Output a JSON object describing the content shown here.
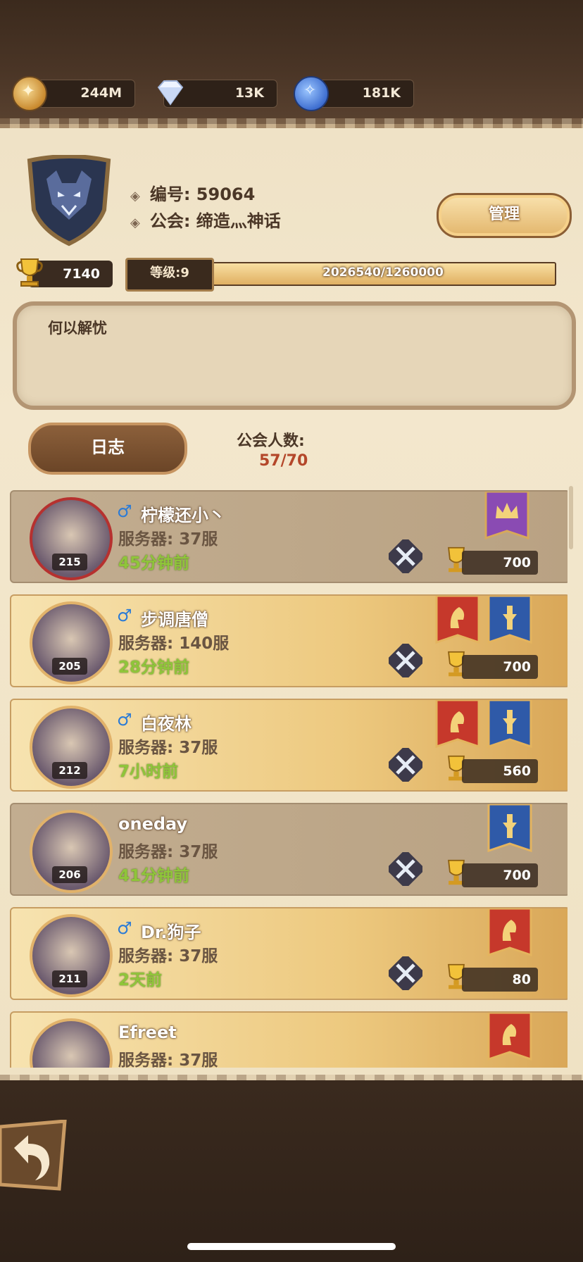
{
  "currencies": [
    {
      "name": "gold-coin-icon",
      "value": "244M"
    },
    {
      "name": "diamond-icon",
      "value": "13K"
    },
    {
      "name": "blue-crystal-icon",
      "value": "181K"
    }
  ],
  "guild": {
    "id_label": "编号: 59064",
    "guild_label": "公会: 缔造灬神话",
    "manage_label": "管理",
    "trophy_value": "7140",
    "level_label": "等级:9",
    "exp_text": "2026540/1260000",
    "notice_text": "何以解忧",
    "log_label": "日志",
    "member_count_label": "公会人数:",
    "member_count_value": "57/70"
  },
  "members": [
    {
      "name": "柠檬还小丶",
      "gender": "♂",
      "server": "服务器: 37服",
      "online": "45分钟前",
      "level": "215",
      "trophy": "700",
      "style": "plain"
    },
    {
      "name": "步调唐僧",
      "gender": "♂",
      "server": "服务器: 140服",
      "online": "28分钟前",
      "level": "205",
      "trophy": "700",
      "style": "gold"
    },
    {
      "name": "白夜林",
      "gender": "♂",
      "server": "服务器: 37服",
      "online": "7小时前",
      "level": "212",
      "trophy": "560",
      "style": "gold"
    },
    {
      "name": "oneday",
      "gender": "",
      "server": "服务器: 37服",
      "online": "41分钟前",
      "level": "206",
      "trophy": "700",
      "style": "plain"
    },
    {
      "name": "Dr.狗子",
      "gender": "♂",
      "server": "服务器: 37服",
      "online": "2天前",
      "level": "211",
      "trophy": "80",
      "style": "gold"
    },
    {
      "name": "Efreet",
      "gender": "",
      "server": "服务器: 37服",
      "online": "",
      "level": "",
      "trophy": "",
      "style": "gold"
    }
  ],
  "colors": {
    "online_green": "#8fc53a",
    "member_count_red": "#b4472a",
    "gender_blue": "#2b7bd6"
  }
}
